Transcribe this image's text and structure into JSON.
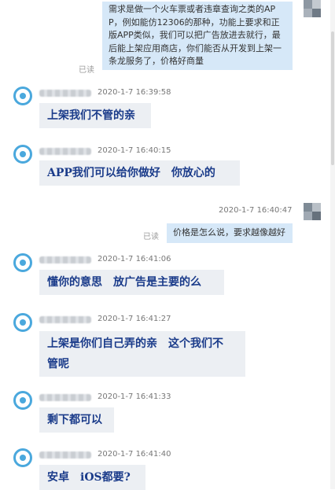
{
  "messages": [
    {
      "type": "outgoing",
      "lines": [
        "需求是做一个火车票或者违章查询之类的AP",
        "P，例如能仿12306的那种，功能上要求和正",
        "版APP类似，我们可以把广告放进去就行，最",
        "后能上架应用商店，你们能否从开发到上架一",
        "条龙服务了，价格好商量"
      ],
      "read_label": "已读"
    },
    {
      "type": "incoming",
      "time": "2020-1-7 16:39:58",
      "lines": [
        "上架我们不管的亲"
      ]
    },
    {
      "type": "incoming",
      "time": "2020-1-7 16:40:15",
      "lines": [
        "APP我们可以给你做好　你放心的"
      ]
    },
    {
      "type": "outgoing",
      "time": "2020-1-7 16:40:47",
      "lines": [
        "价格是怎么说，要求越像越好"
      ],
      "read_label": "已读"
    },
    {
      "type": "incoming",
      "time": "2020-1-7 16:41:06",
      "lines": [
        "懂你的意思　放广告是主要的么"
      ]
    },
    {
      "type": "incoming",
      "time": "2020-1-7 16:41:27",
      "lines": [
        "上架是你们自己弄的亲　这个我们不",
        "管呢"
      ]
    },
    {
      "type": "incoming",
      "time": "2020-1-7 16:41:33",
      "lines": [
        "剩下都可以"
      ]
    },
    {
      "type": "incoming",
      "time": "2020-1-7 16:41:40",
      "lines": [
        "安卓　iOS都要?"
      ]
    }
  ],
  "colors": {
    "incoming_bubble": "#eceff3",
    "incoming_text": "#1a3b8a",
    "outgoing_bubble": "#d6e8f8",
    "avatar_ring": "#4aa8dd"
  }
}
